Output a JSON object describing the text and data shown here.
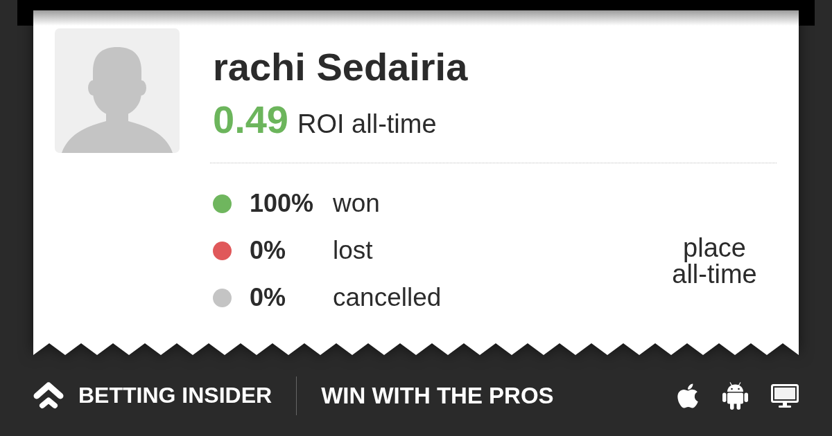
{
  "profile": {
    "name": "rachi Sedairia",
    "roi": {
      "value": "0.49",
      "label": "ROI all-time"
    }
  },
  "stats": [
    {
      "value": "100%",
      "label": "won",
      "color": "#6fb65e"
    },
    {
      "value": "0%",
      "label": "lost",
      "color": "#e0585a"
    },
    {
      "value": "0%",
      "label": "cancelled",
      "color": "#c4c4c4"
    }
  ],
  "place": {
    "label": "place all-time"
  },
  "footer": {
    "brand": "BETTING INSIDER",
    "tagline": "WIN WITH THE PROS",
    "platforms": [
      {
        "kind": "apple"
      },
      {
        "kind": "android"
      },
      {
        "kind": "desktop"
      }
    ]
  }
}
